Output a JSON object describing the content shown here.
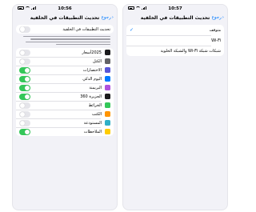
{
  "left": {
    "status": {
      "time": "10:56"
    },
    "nav": {
      "back_label": "رجوع",
      "title": "تحديث التطبيقات في الخلفية"
    },
    "main_toggle": {
      "label": "تحديث التطبيقات في الخلفية",
      "on": false
    },
    "apps": [
      {
        "name": "2025أسعار",
        "icon": "app-icon",
        "color": "#1c1c1e",
        "on": false
      },
      {
        "name": "الكتل",
        "icon": "app-icon",
        "color": "#636366",
        "on": false
      },
      {
        "name": "الاختصارات",
        "icon": "shortcuts-icon",
        "color": "#5856d6",
        "on": true
      },
      {
        "name": "اليوم الذكي",
        "icon": "app-icon",
        "color": "#007aff",
        "on": true
      },
      {
        "name": "البريمنة",
        "icon": "app-icon",
        "color": "#af52de",
        "on": true
      },
      {
        "name": "الجزيرة 360",
        "icon": "app-icon",
        "color": "#1c1c1e",
        "on": true
      },
      {
        "name": "الخرائط",
        "icon": "maps-icon",
        "color": "#34c759",
        "on": false
      },
      {
        "name": "الكتب",
        "icon": "books-icon",
        "color": "#ff9500",
        "on": false
      },
      {
        "name": "المستودعة",
        "icon": "app-icon",
        "color": "#30b0c7",
        "on": false
      },
      {
        "name": "الملاحظات",
        "icon": "notes-icon",
        "color": "#ffcc00",
        "on": true
      }
    ]
  },
  "right": {
    "status": {
      "time": "10:57"
    },
    "nav": {
      "back_label": "رجوع",
      "title": "تحديث التطبيقات في الخلفية"
    },
    "options": [
      {
        "label": "متوقف",
        "selected": true
      },
      {
        "label": "Wi-Fi",
        "selected": false
      },
      {
        "label": "شبكات شبكة Wi-Fi والشبكة الخلوية",
        "selected": false
      }
    ]
  },
  "colors": {
    "accent": "#007aff",
    "toggle_on": "#34c759",
    "toggle_off": "#e5e5ea"
  }
}
